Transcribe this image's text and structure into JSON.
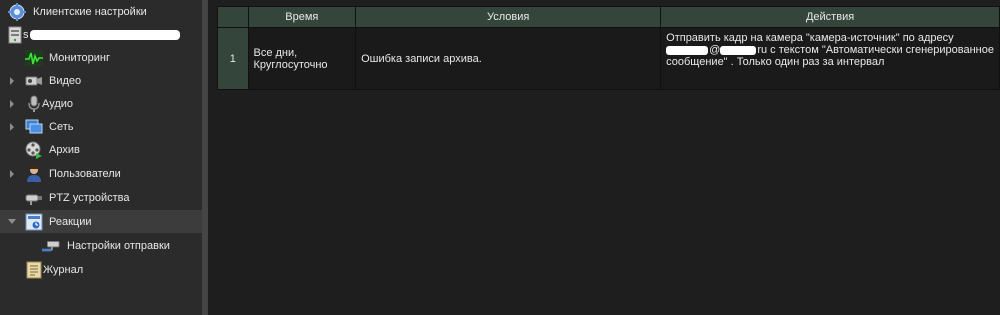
{
  "sidebar": {
    "client_settings": "Клиентские настройки",
    "server_prefix": "s",
    "items": [
      {
        "label": "Мониторинг",
        "icon": "monitoring-icon"
      },
      {
        "label": "Видео",
        "icon": "video-camera-icon"
      },
      {
        "label": "Аудио",
        "icon": "microphone-icon"
      },
      {
        "label": "Сеть",
        "icon": "network-icon"
      },
      {
        "label": "Архив",
        "icon": "archive-reel-icon"
      },
      {
        "label": "Пользователи",
        "icon": "users-icon"
      },
      {
        "label": "PTZ устройства",
        "icon": "ptz-camera-icon"
      },
      {
        "label": "Реакции",
        "icon": "reactions-icon"
      },
      {
        "label": "Настройки отправки",
        "icon": "send-settings-icon"
      },
      {
        "label": "Журнал",
        "icon": "journal-icon"
      }
    ]
  },
  "table": {
    "headers": [
      "",
      "Время",
      "Условия",
      "Действия"
    ],
    "rows": [
      {
        "num": "1",
        "time_line1": "Все дни,",
        "time_line2": "Круглосуточно",
        "condition": "Ошибка записи архива.",
        "action_line1": "Отправить кадр на камера \"камера-источник\" по адресу",
        "action_line2_pre": "@",
        "action_line2_post": "ru с текстом \"Автоматически сгенерированное",
        "action_line3": "сообщение\" . Только один раз за интервал"
      }
    ]
  },
  "colors": {
    "header_bg": "#34453c",
    "sidebar_bg": "#2b2b2b",
    "main_bg": "#1e1e1e",
    "selected_row": "#3c3c3c"
  }
}
